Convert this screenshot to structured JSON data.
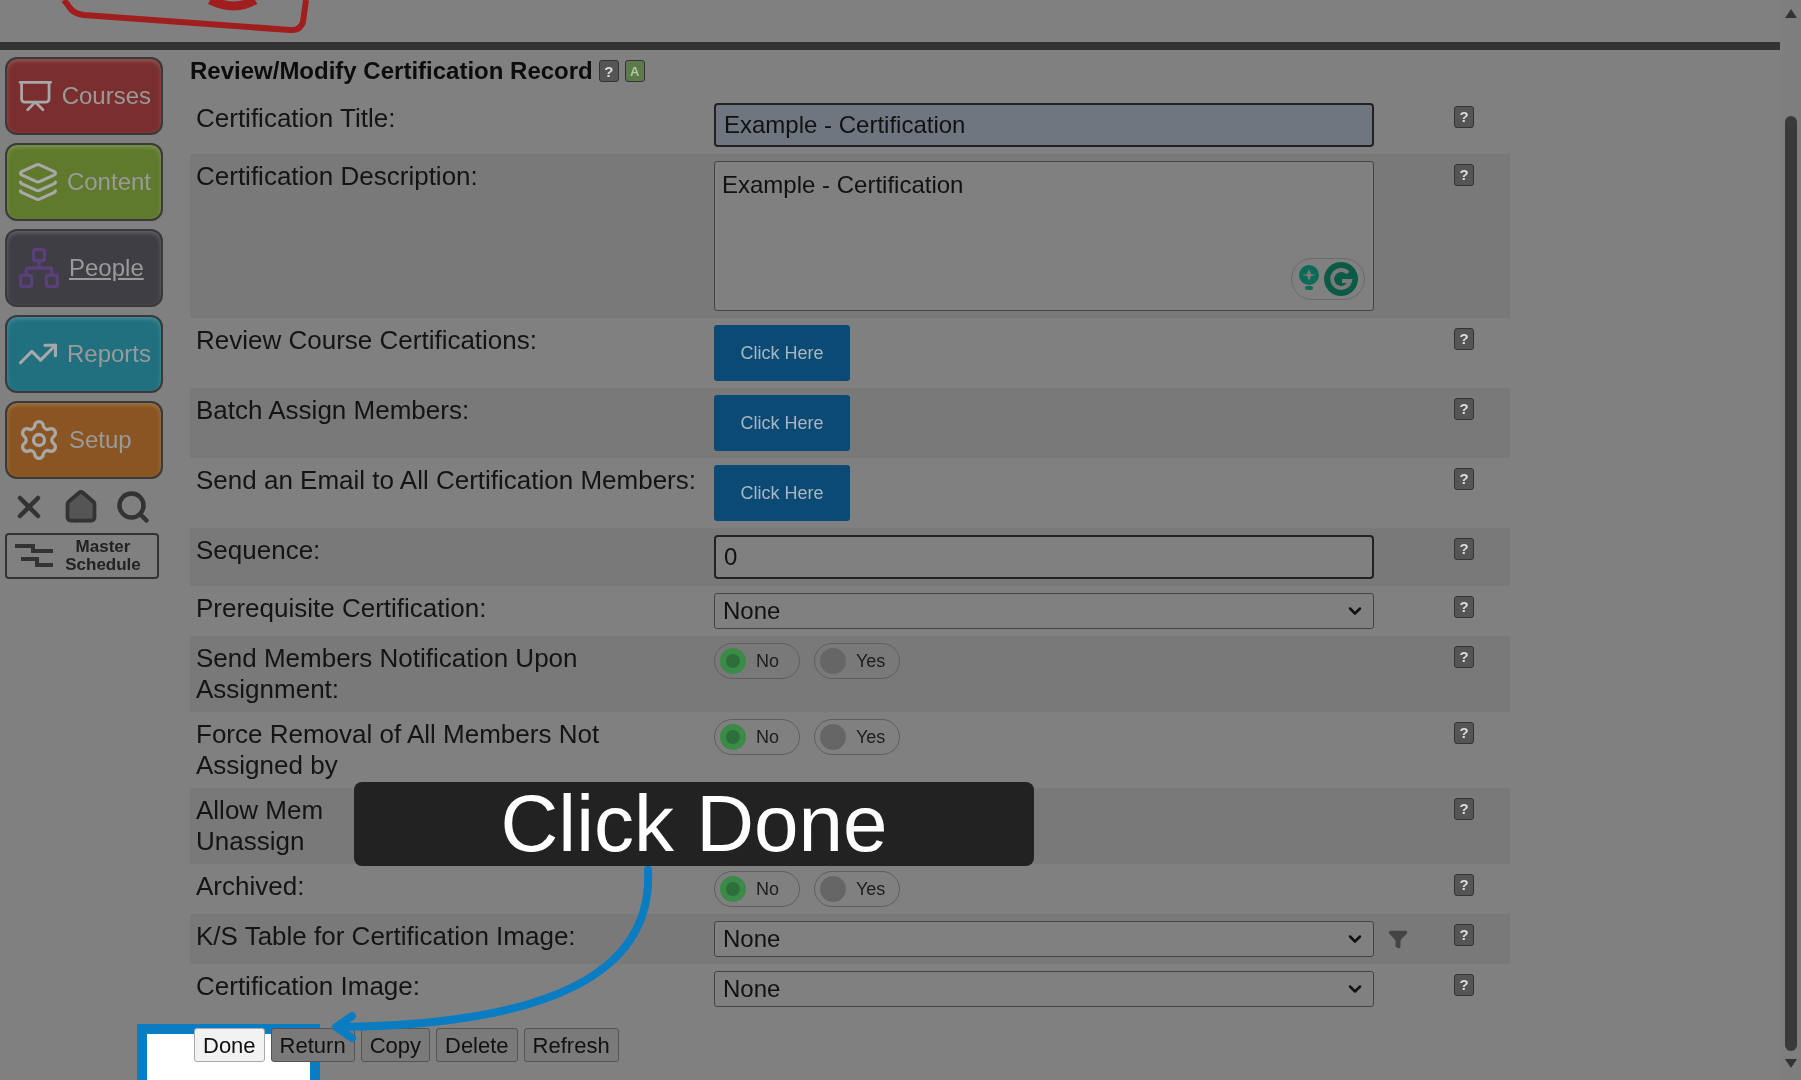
{
  "title": "Review/Modify Certification Record",
  "title_icons": [
    {
      "kind": "help",
      "text": "?"
    },
    {
      "kind": "badge",
      "text": "A"
    }
  ],
  "sidebar": {
    "items": [
      {
        "label": "Courses",
        "kind": "courses",
        "selected": false
      },
      {
        "label": "Content",
        "kind": "content",
        "selected": false
      },
      {
        "label": "People",
        "kind": "people",
        "selected": true
      },
      {
        "label": "Reports",
        "kind": "reports",
        "selected": false
      },
      {
        "label": "Setup",
        "kind": "setup",
        "selected": false
      }
    ],
    "master_schedule": "Master Schedule"
  },
  "form": {
    "rows": [
      {
        "label": "Certification Title:",
        "kind": "text",
        "value": "Example - Certification",
        "help": "?"
      },
      {
        "label": "Certification Description:",
        "kind": "textarea",
        "value": "Example - Certification",
        "help": "?"
      },
      {
        "label": "Review Course Certifications:",
        "kind": "button",
        "button": "Click Here",
        "help": "?"
      },
      {
        "label": "Batch Assign Members:",
        "kind": "button",
        "button": "Click Here",
        "help": "?"
      },
      {
        "label": "Send an Email to All Certification Members:",
        "kind": "button",
        "button": "Click Here",
        "help": "?"
      },
      {
        "label": "Sequence:",
        "kind": "text",
        "value": "0",
        "help": "?"
      },
      {
        "label": "Prerequisite Certification:",
        "kind": "select",
        "value": "None",
        "help": "?"
      },
      {
        "label": "Send Members Notification Upon Assignment:",
        "kind": "toggle",
        "options": [
          {
            "label": "No",
            "selected": true
          },
          {
            "label": "Yes",
            "selected": false
          }
        ],
        "help": "?"
      },
      {
        "label": [
          "Force Removal of All Members Not",
          "Assigned by"
        ],
        "kind": "toggle",
        "options": [
          {
            "label": "No",
            "selected": true
          },
          {
            "label": "Yes",
            "selected": false
          }
        ],
        "help": "?"
      },
      {
        "label": [
          "Allow Mem",
          "Unassign"
        ],
        "kind": "covered",
        "help": "?"
      },
      {
        "label": "Archived:",
        "kind": "toggle",
        "options": [
          {
            "label": "No",
            "selected": true
          },
          {
            "label": "Yes",
            "selected": false
          }
        ],
        "help": "?"
      },
      {
        "label": "K/S Table for Certification Image:",
        "kind": "select",
        "value": "None",
        "filter": true,
        "help": "?"
      },
      {
        "label": "Certification Image:",
        "kind": "select",
        "value": "None",
        "help": "?"
      }
    ]
  },
  "buttons": [
    {
      "label": "Done",
      "highlighted": true
    },
    {
      "label": "Return",
      "highlighted": false
    },
    {
      "label": "Copy",
      "highlighted": false
    },
    {
      "label": "Delete",
      "highlighted": false
    },
    {
      "label": "Refresh",
      "highlighted": false
    }
  ],
  "callout": {
    "text": "Click Done"
  }
}
